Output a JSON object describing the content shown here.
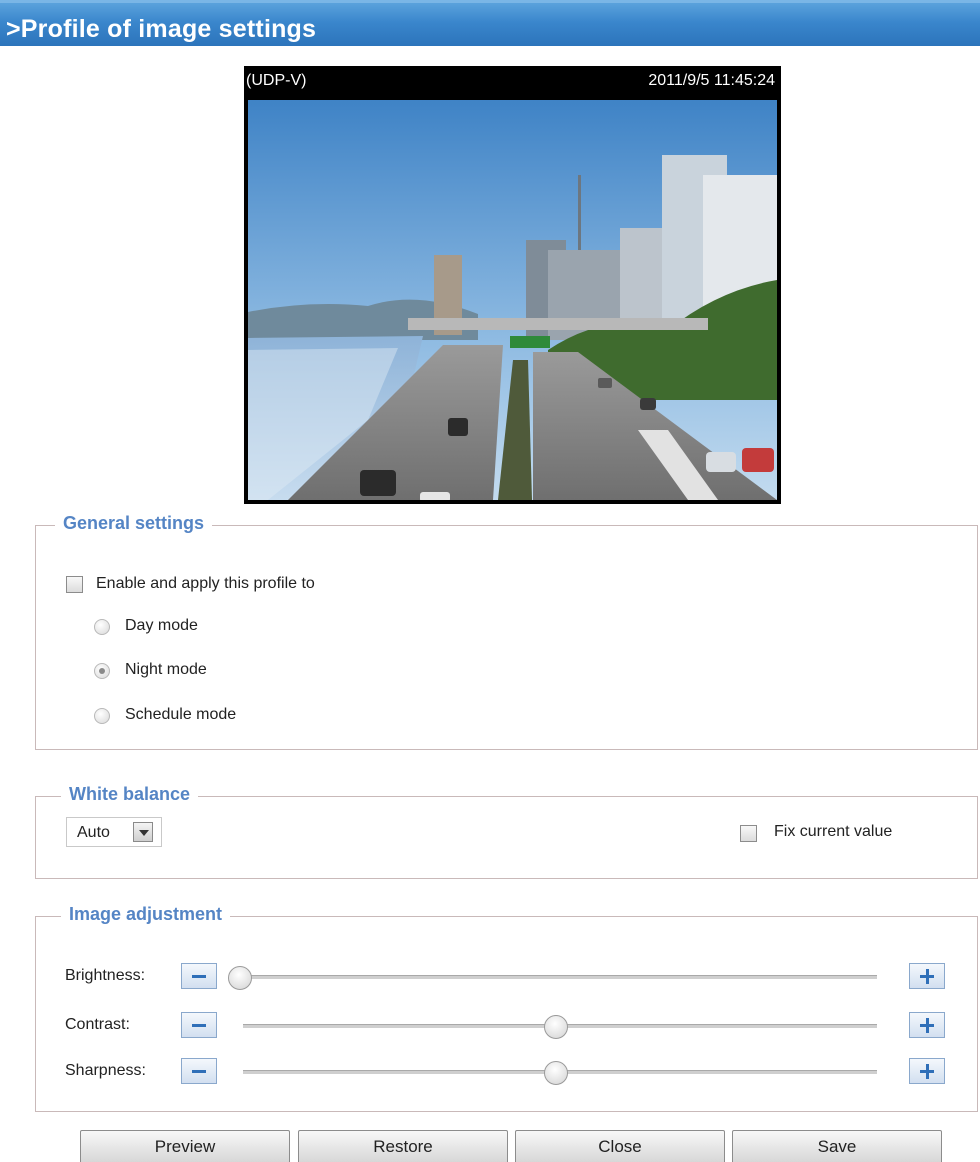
{
  "header": {
    "title": ">Profile of image settings"
  },
  "video": {
    "protocol": "(UDP-V)",
    "timestamp": "2011/9/5 11:45:24"
  },
  "general_settings": {
    "legend": "General settings",
    "enable_label": "Enable and apply this profile to",
    "enable_checked": false,
    "modes": [
      {
        "label": "Day mode",
        "selected": false
      },
      {
        "label": "Night mode",
        "selected": true
      },
      {
        "label": "Schedule mode",
        "selected": false
      }
    ]
  },
  "white_balance": {
    "legend": "White balance",
    "selected": "Auto",
    "fix_label": "Fix current value",
    "fix_checked": false
  },
  "image_adjustment": {
    "legend": "Image adjustment",
    "sliders": [
      {
        "label": "Brightness:",
        "value_fraction": 0.0
      },
      {
        "label": "Contrast:",
        "value_fraction": 0.5
      },
      {
        "label": "Sharpness:",
        "value_fraction": 0.5
      }
    ]
  },
  "buttons": {
    "preview": "Preview",
    "restore": "Restore",
    "close": "Close",
    "save": "Save"
  },
  "icons": {
    "decrease": "minus-icon",
    "increase": "plus-icon",
    "dropdown": "chevron-down-icon"
  }
}
